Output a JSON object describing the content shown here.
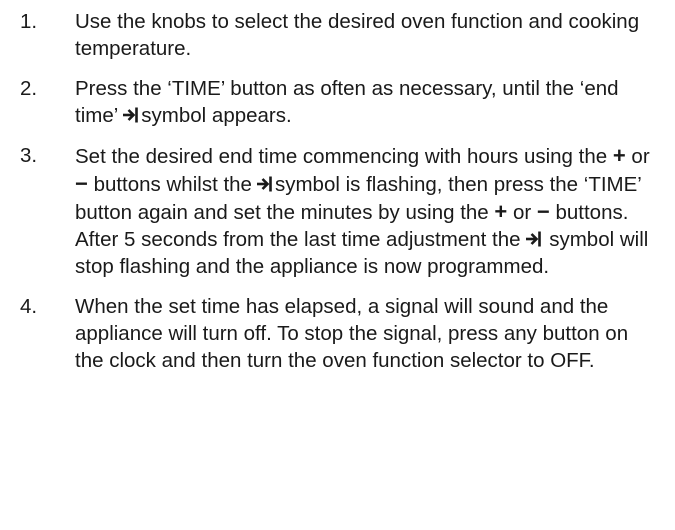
{
  "steps": [
    {
      "number": "1.",
      "parts": [
        "Use the knobs to select the desired oven function and cooking temperature."
      ]
    },
    {
      "number": "2.",
      "parts": [
        "Press the ‘TIME’ button as often as necessary, until the ‘end time’",
        "symbol appears."
      ]
    },
    {
      "number": "3.",
      "parts": [
        "Set the desired end time commencing with hours using the",
        "+",
        "or",
        "−",
        "buttons whilst the",
        "symbol is flashing, then press the ‘TIME’ button again and set the minutes by using the",
        "+",
        "or",
        "−",
        "buttons. After 5 seconds from the last time adjustment the",
        "symbol will stop flashing and the appliance is now programmed."
      ]
    },
    {
      "number": "4.",
      "parts": [
        "When the set time has elapsed, a signal will sound and the appliance will turn off. To stop the signal, press any button on the clock and then turn the oven function selector to OFF."
      ]
    }
  ],
  "icons": {
    "end_time": "end-time-arrow-to-bar-icon"
  }
}
